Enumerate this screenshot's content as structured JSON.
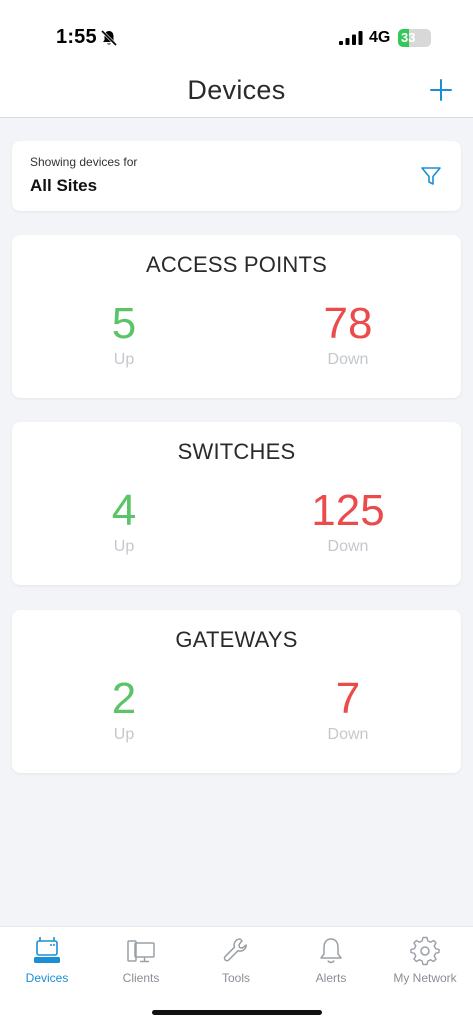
{
  "status": {
    "time": "1:55",
    "network": "4G",
    "battery": "33",
    "battery_level": 0.33
  },
  "nav": {
    "title": "Devices"
  },
  "filter": {
    "caption": "Showing devices for",
    "value": "All Sites"
  },
  "cards": [
    {
      "title": "ACCESS POINTS",
      "up": "5",
      "up_label": "Up",
      "down": "78",
      "down_label": "Down"
    },
    {
      "title": "SWITCHES",
      "up": "4",
      "up_label": "Up",
      "down": "125",
      "down_label": "Down"
    },
    {
      "title": "GATEWAYS",
      "up": "2",
      "up_label": "Up",
      "down": "7",
      "down_label": "Down"
    }
  ],
  "tabs": [
    {
      "label": "Devices",
      "icon": "devices-icon",
      "active": true
    },
    {
      "label": "Clients",
      "icon": "clients-icon",
      "active": false
    },
    {
      "label": "Tools",
      "icon": "wrench-icon",
      "active": false
    },
    {
      "label": "Alerts",
      "icon": "bell-icon",
      "active": false
    },
    {
      "label": "My Network",
      "icon": "gear-icon",
      "active": false
    }
  ],
  "colors": {
    "accent": "#1a8fd6",
    "up": "#5cc468",
    "down": "#ec4b4b",
    "battery": "#34c759"
  }
}
